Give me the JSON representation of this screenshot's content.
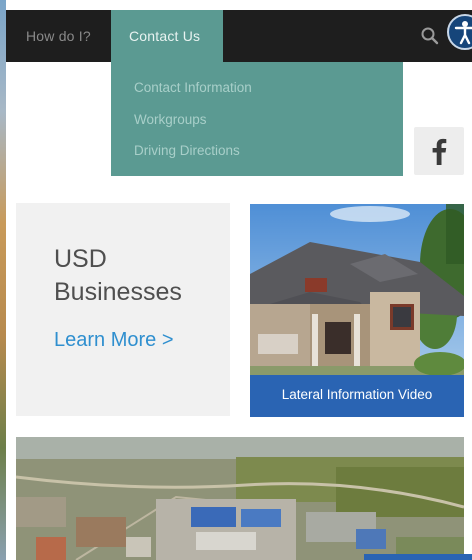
{
  "nav": {
    "how_label": "How do I?",
    "contact_label": "Contact Us",
    "search_icon": "search-icon",
    "accessibility_icon": "accessibility-icon"
  },
  "dropdown": {
    "items": [
      {
        "label": "Contact Information"
      },
      {
        "label": "Workgroups"
      },
      {
        "label": "Driving Directions"
      }
    ]
  },
  "social": {
    "facebook_icon": "facebook-icon"
  },
  "card": {
    "title": "USD\nBusinesses",
    "link": "Learn More >"
  },
  "video": {
    "label": "Lateral Information Video"
  },
  "colors": {
    "nav_bg": "#1e1e1e",
    "accent_teal": "#5b9a92",
    "link_blue": "#2f8fcf",
    "video_bar_blue": "#2a64b3",
    "accessibility_blue": "#16457a"
  }
}
